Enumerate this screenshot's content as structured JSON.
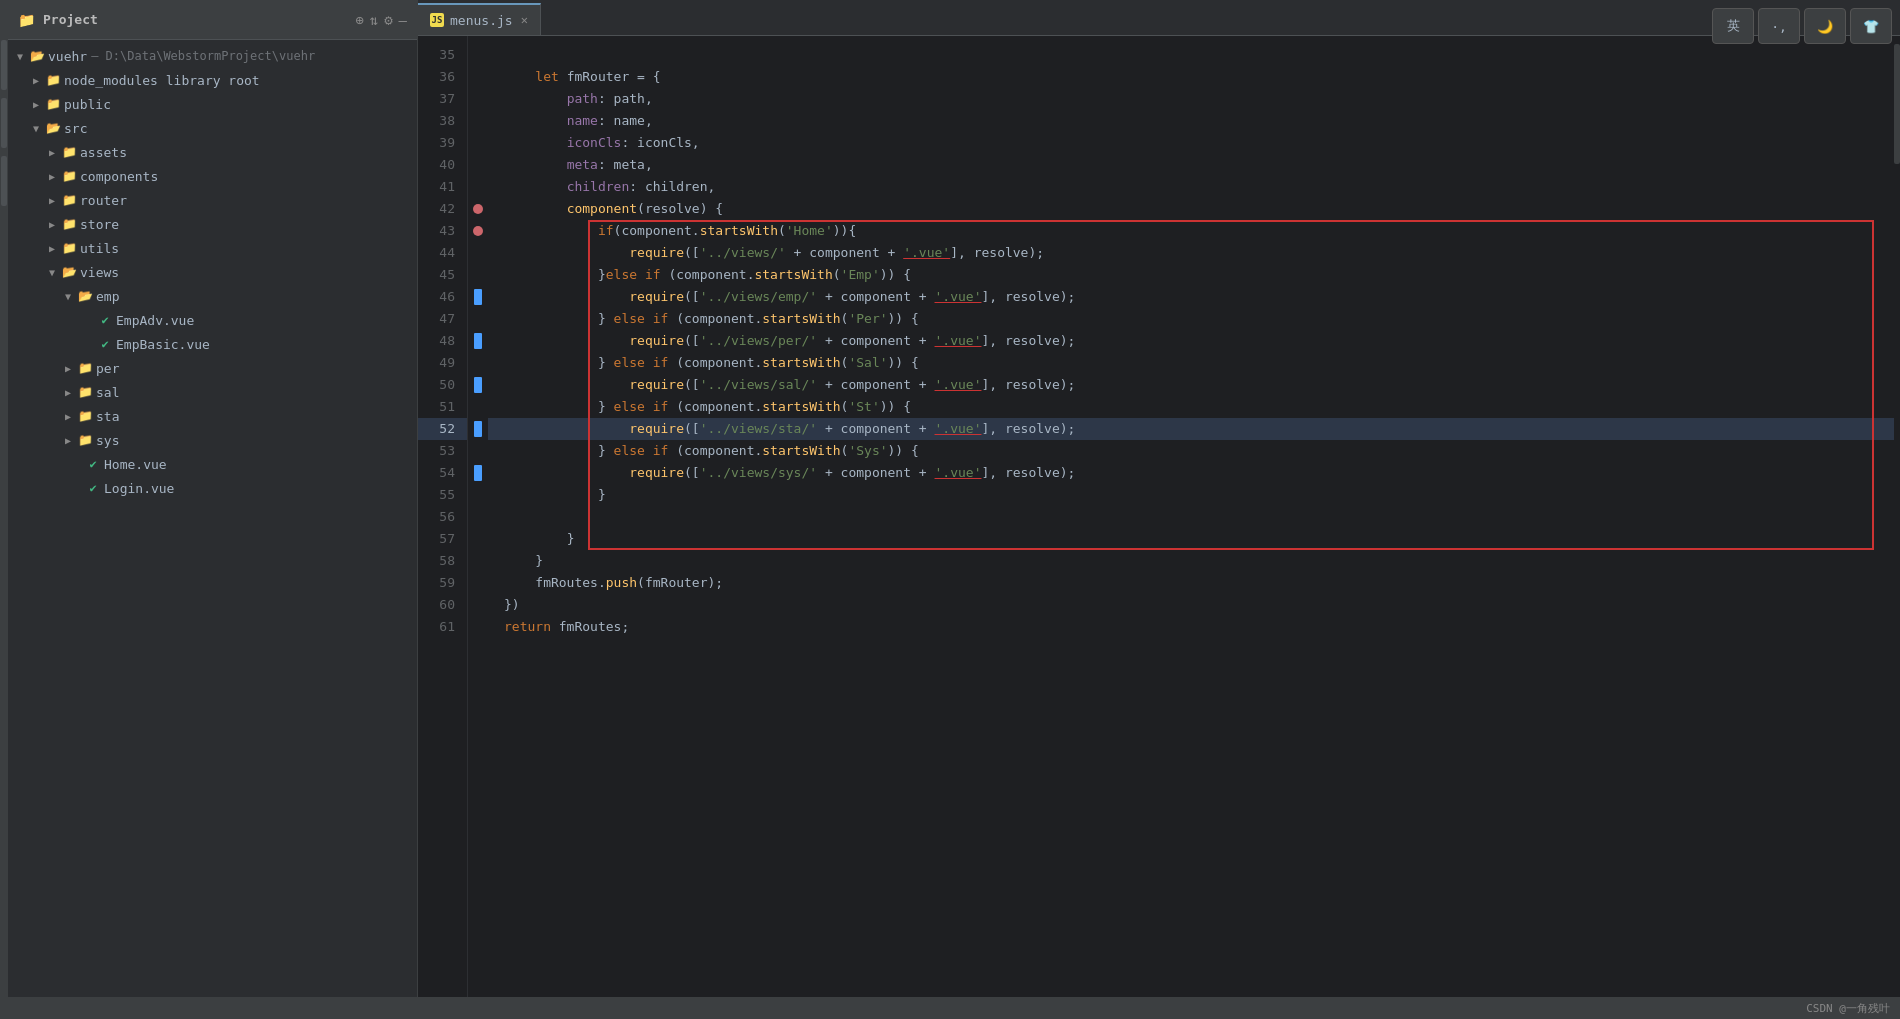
{
  "app": {
    "title": "Project"
  },
  "toolbar": {
    "buttons": [
      "英",
      "·,",
      "🌙",
      "👕"
    ]
  },
  "project_panel": {
    "title": "Project",
    "root": "vuehr",
    "root_path": "D:\\Data\\WebstormProject\\vuehr",
    "items": [
      {
        "id": "node_modules",
        "label": "node_modules  library root",
        "indent": 1,
        "type": "folder",
        "expanded": false
      },
      {
        "id": "public",
        "label": "public",
        "indent": 1,
        "type": "folder",
        "expanded": false
      },
      {
        "id": "src",
        "label": "src",
        "indent": 1,
        "type": "folder",
        "expanded": true
      },
      {
        "id": "assets",
        "label": "assets",
        "indent": 2,
        "type": "folder",
        "expanded": false
      },
      {
        "id": "components",
        "label": "components",
        "indent": 2,
        "type": "folder",
        "expanded": false
      },
      {
        "id": "router",
        "label": "router",
        "indent": 2,
        "type": "folder",
        "expanded": false
      },
      {
        "id": "store",
        "label": "store",
        "indent": 2,
        "type": "folder",
        "expanded": false
      },
      {
        "id": "utils",
        "label": "utils",
        "indent": 2,
        "type": "folder",
        "expanded": false
      },
      {
        "id": "views",
        "label": "views",
        "indent": 2,
        "type": "folder",
        "expanded": true
      },
      {
        "id": "emp",
        "label": "emp",
        "indent": 3,
        "type": "folder",
        "expanded": true
      },
      {
        "id": "EmpAdv.vue",
        "label": "EmpAdv.vue",
        "indent": 4,
        "type": "vue"
      },
      {
        "id": "EmpBasic.vue",
        "label": "EmpBasic.vue",
        "indent": 4,
        "type": "vue"
      },
      {
        "id": "per",
        "label": "per",
        "indent": 3,
        "type": "folder",
        "expanded": false
      },
      {
        "id": "sal",
        "label": "sal",
        "indent": 3,
        "type": "folder",
        "expanded": false
      },
      {
        "id": "sta",
        "label": "sta",
        "indent": 3,
        "type": "folder",
        "expanded": false
      },
      {
        "id": "sys",
        "label": "sys",
        "indent": 3,
        "type": "folder",
        "expanded": false
      },
      {
        "id": "Home.vue",
        "label": "Home.vue",
        "indent": 3,
        "type": "vue"
      },
      {
        "id": "Login.vue",
        "label": "Login.vue",
        "indent": 3,
        "type": "vue"
      }
    ]
  },
  "editor": {
    "tab_filename": "menus.js",
    "lines": [
      {
        "num": 35,
        "content": ""
      },
      {
        "num": 36,
        "content": "    let fmRouter = {"
      },
      {
        "num": 37,
        "content": "        path: path,"
      },
      {
        "num": 38,
        "content": "        name: name,"
      },
      {
        "num": 39,
        "content": "        iconCls: iconCls,"
      },
      {
        "num": 40,
        "content": "        meta: meta,"
      },
      {
        "num": 41,
        "content": "        children: children,"
      },
      {
        "num": 42,
        "content": "        component(resolve) {"
      },
      {
        "num": 43,
        "content": "            if(component.startsWith('Home')){"
      },
      {
        "num": 44,
        "content": "                require(['../views/' + component + '.vue'], resolve);"
      },
      {
        "num": 45,
        "content": "            }else if (component.startsWith('Emp')) {"
      },
      {
        "num": 46,
        "content": "                require(['../views/emp/' + component + '.vue'], resolve);"
      },
      {
        "num": 47,
        "content": "            } else if (component.startsWith('Per')) {"
      },
      {
        "num": 48,
        "content": "                require(['../views/per/' + component + '.vue'], resolve);"
      },
      {
        "num": 49,
        "content": "            } else if (component.startsWith('Sal')) {"
      },
      {
        "num": 50,
        "content": "                require(['../views/sal/' + component + '.vue'], resolve);"
      },
      {
        "num": 51,
        "content": "            } else if (component.startsWith('St')) {"
      },
      {
        "num": 52,
        "content": "                require(['../views/sta/' + component + '.vue'], resolve);",
        "current": true
      },
      {
        "num": 53,
        "content": "            } else if (component.startsWith('Sys')) {"
      },
      {
        "num": 54,
        "content": "                require(['../views/sys/' + component + '.vue'], resolve);"
      },
      {
        "num": 55,
        "content": "            }"
      },
      {
        "num": 56,
        "content": ""
      },
      {
        "num": 57,
        "content": "        }"
      },
      {
        "num": 58,
        "content": "    }"
      },
      {
        "num": 59,
        "content": "    fmRoutes.push(fmRouter);"
      },
      {
        "num": 60,
        "content": "})"
      },
      {
        "num": 61,
        "content": "return fmRoutes;"
      }
    ]
  },
  "status_bar": {
    "right_text": "CSDN @一角残叶"
  }
}
